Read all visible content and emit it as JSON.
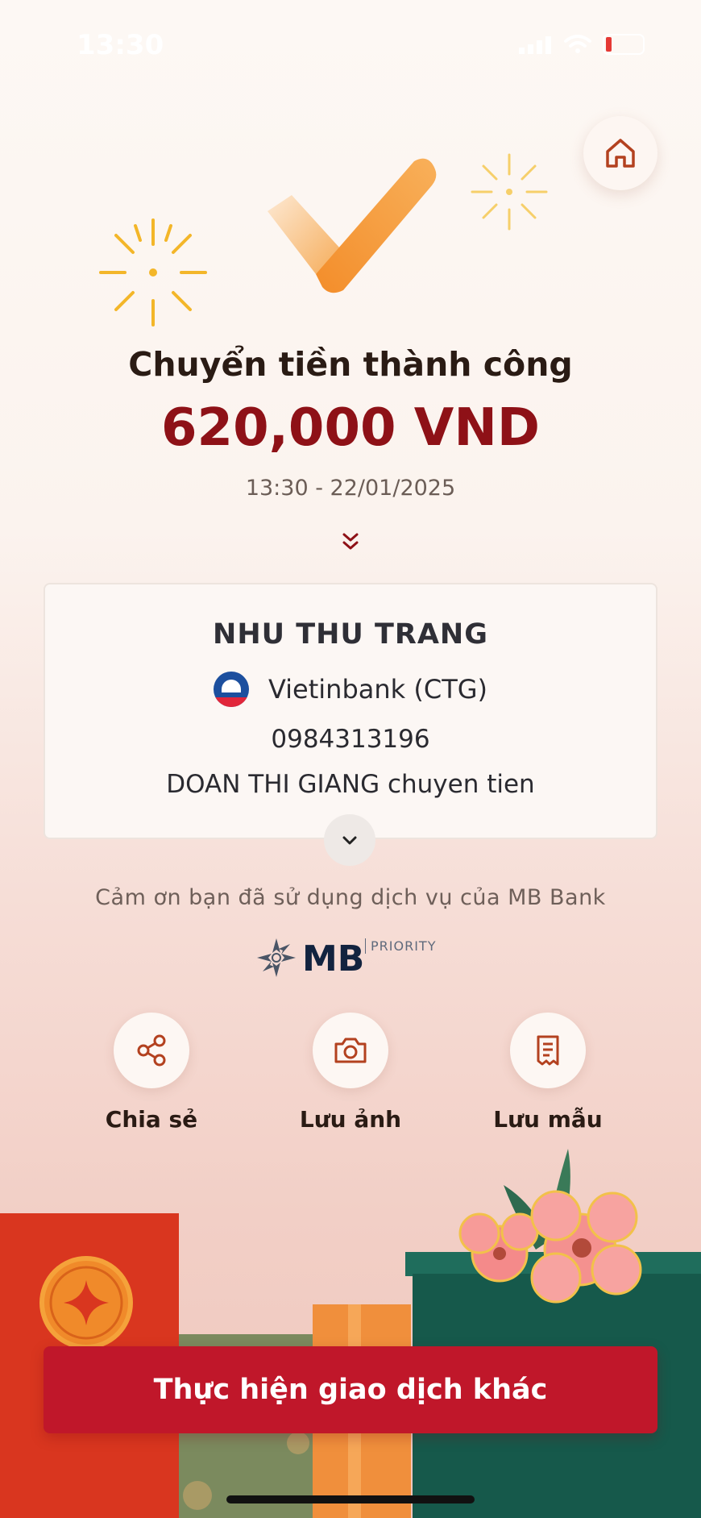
{
  "status_bar": {
    "time": "13:30"
  },
  "header": {
    "home_icon": "home-icon"
  },
  "result": {
    "title": "Chuyển tiền thành công",
    "amount": "620,000 VND",
    "datetime": "13:30 - 22/01/2025"
  },
  "recipient": {
    "name": "NHU THU TRANG",
    "bank": "Vietinbank (CTG)",
    "account_number": "0984313196",
    "note": "DOAN THI GIANG chuyen tien"
  },
  "footer": {
    "thanks": "Cảm ơn bạn đã sử dụng dịch vụ của MB Bank",
    "brand": "MB",
    "brand_tier": "PRIORITY"
  },
  "actions": [
    {
      "label": "Chia sẻ",
      "icon": "share-icon"
    },
    {
      "label": "Lưu ảnh",
      "icon": "camera-icon"
    },
    {
      "label": "Lưu mẫu",
      "icon": "receipt-icon"
    }
  ],
  "cta": {
    "label": "Thực hiện giao dịch khác"
  },
  "colors": {
    "amount": "#8e1117",
    "cta_background": "#c0172a",
    "icon_accent": "#b3411f",
    "check_orange": "#f59a3a"
  }
}
